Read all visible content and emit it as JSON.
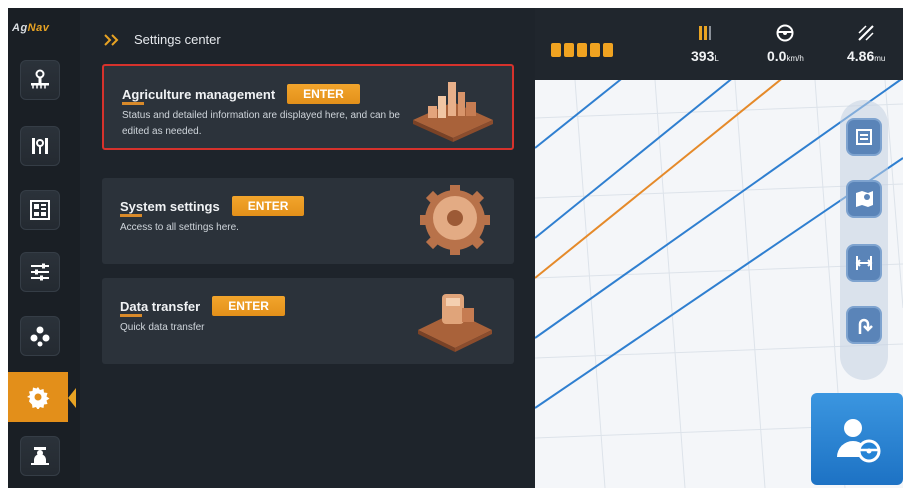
{
  "brand": {
    "logo_prefix": "Ag",
    "logo_suffix": "Nav"
  },
  "sidebar": {
    "items": [
      {
        "icon": "implement-icon"
      },
      {
        "icon": "calibration-icon"
      },
      {
        "icon": "field-layout-icon"
      },
      {
        "icon": "sliders-icon"
      },
      {
        "icon": "connect-nodes-icon"
      },
      {
        "icon": "gear-icon",
        "active": true
      },
      {
        "icon": "operator-icon"
      }
    ]
  },
  "panel": {
    "title": "Settings center",
    "cards": [
      {
        "title": "Agriculture management",
        "enter_label": "ENTER",
        "description": "Status and detailed information are displayed here, and can be edited as needed.",
        "selected": true
      },
      {
        "title": "System settings",
        "enter_label": "ENTER",
        "description": "Access to all settings here.",
        "selected": false
      },
      {
        "title": "Data transfer",
        "enter_label": "ENTER",
        "description": "Quick data transfer",
        "selected": false
      }
    ]
  },
  "status": {
    "counter_digits": 5,
    "fuel": {
      "value": "393",
      "unit": "L"
    },
    "speed": {
      "value": "0.0",
      "unit": "km/h"
    },
    "area": {
      "value": "4.86",
      "unit": "mu"
    }
  },
  "map_tools": [
    "guidance-line-icon",
    "map-marker-icon",
    "ab-line-width-icon",
    "u-turn-icon"
  ],
  "colors": {
    "accent": "#e8a323",
    "selection": "#d6322c",
    "guidance_blue": "#2f7fd0",
    "guidance_orange": "#e58a2a"
  }
}
